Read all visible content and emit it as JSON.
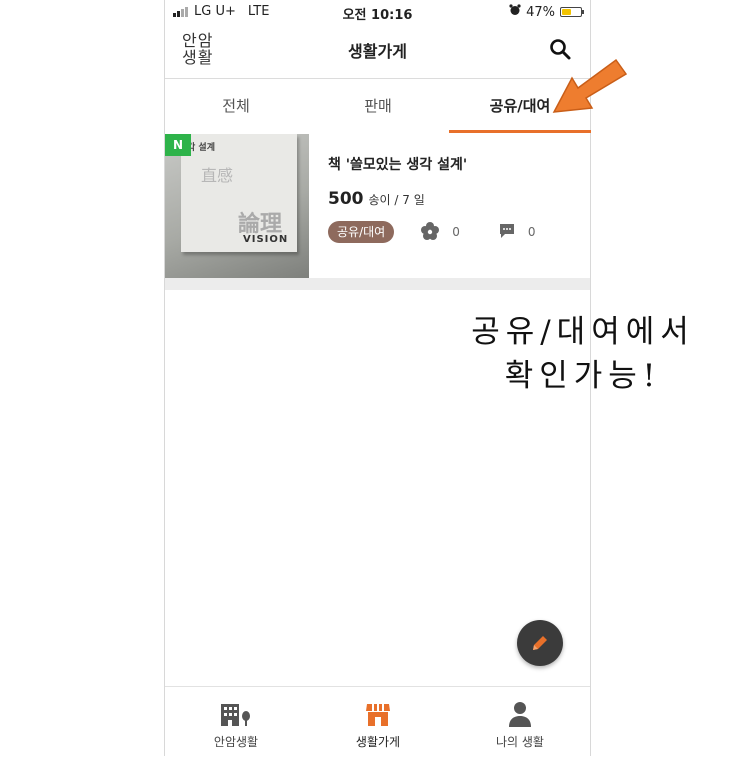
{
  "status_bar": {
    "carrier": "LG U+",
    "network": "LTE",
    "time": "오전 10:16",
    "battery": "47%"
  },
  "header": {
    "logo_line1": "안암",
    "logo_line2": "생활",
    "title": "생활가게"
  },
  "tabs": [
    {
      "label": "전체",
      "active": false
    },
    {
      "label": "판매",
      "active": false
    },
    {
      "label": "공유/대여",
      "active": true
    }
  ],
  "item": {
    "badge": "N",
    "title": "책 '쓸모있는 생각 설계'",
    "price": "500",
    "unit": "송이 / 7 일",
    "tag": "공유/대여",
    "likes": "0",
    "comments": "0",
    "cover_text": {
      "line1": "각 설계",
      "line2": "直感",
      "line3": "論理",
      "line4": "VISION"
    }
  },
  "bottom_nav": [
    {
      "label": "안암생활",
      "active": false
    },
    {
      "label": "생활가게",
      "active": true
    },
    {
      "label": "나의 생활",
      "active": false
    }
  ],
  "annotation": {
    "line1": "공유/대여에서",
    "line2": "확인가능!"
  },
  "colors": {
    "accent": "#e8702a",
    "tag": "#8e6a5d",
    "badge": "#2eb34a",
    "fab": "#3b3b3b"
  }
}
